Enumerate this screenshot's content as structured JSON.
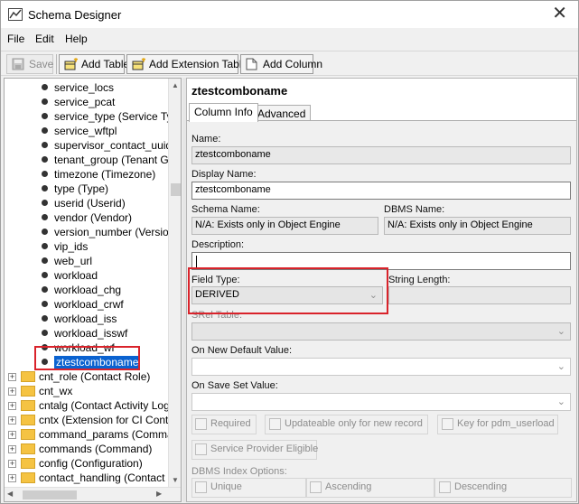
{
  "window": {
    "title": "Schema Designer",
    "close_glyph": "✕"
  },
  "menu": {
    "file": "File",
    "edit": "Edit",
    "help": "Help"
  },
  "toolbar": {
    "save": "Save",
    "add_table": "Add Table",
    "add_extension_table": "Add Extension Table",
    "add_column": "Add Column"
  },
  "tree": {
    "columns": [
      "service_locs",
      "service_pcat",
      "service_type (Service Typ",
      "service_wftpl",
      "supervisor_contact_uuid (",
      "tenant_group (Tenant Gro",
      "timezone (Timezone)",
      "type (Type)",
      "userid (Userid)",
      "vendor (Vendor)",
      "version_number (Version",
      "vip_ids",
      "web_url",
      "workload",
      "workload_chg",
      "workload_crwf",
      "workload_iss",
      "workload_isswf",
      "workload_wf",
      "ztestcomboname"
    ],
    "selected_index": 19,
    "tables": [
      "cnt_role (Contact Role)",
      "cnt_wx",
      "cntalg (Contact Activity Log)",
      "cntx (Extension for CI Contac",
      "command_params (Command",
      "commands (Command)",
      "config (Configuration)",
      "contact_handling (Contact Ha"
    ]
  },
  "panel": {
    "title": "ztestcomboname",
    "tabs": [
      "Column Info",
      "Advanced"
    ],
    "active_tab": 0,
    "name_label": "Name:",
    "name_value": "ztestcomboname",
    "display_name_label": "Display Name:",
    "display_name_value": "ztestcomboname",
    "schema_name_label": "Schema Name:",
    "schema_name_value": "N/A: Exists only in Object Engine",
    "dbms_name_label": "DBMS Name:",
    "dbms_name_value": "N/A: Exists only in Object Engine",
    "description_label": "Description:",
    "description_value": "",
    "field_type_label": "Field Type:",
    "field_type_value": "DERIVED",
    "string_length_label": "String Length:",
    "srel_table_label": "SRel Table:",
    "on_new_default_label": "On New Default Value:",
    "on_save_set_label": "On Save Set Value:",
    "required_label": "Required",
    "updateable_label": "Updateable only for new record",
    "key_label": "Key for pdm_userload",
    "service_provider_label": "Service Provider Eligible",
    "dbms_index_label": "DBMS Index Options:",
    "unique_label": "Unique",
    "ascending_label": "Ascending",
    "descending_label": "Descending"
  },
  "colors": {
    "highlight": "#d9232b",
    "selection": "#0a62d0"
  },
  "icons": [
    "app-icon",
    "save-icon",
    "add-table-icon",
    "add-extension-table-icon",
    "add-column-icon",
    "folder-icon",
    "bullet-icon",
    "chevron-down-icon"
  ]
}
